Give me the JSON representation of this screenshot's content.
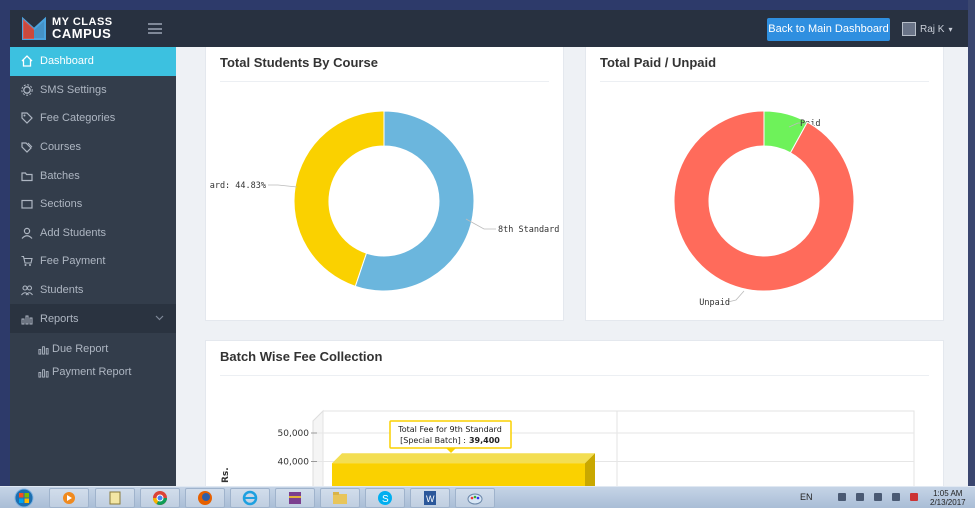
{
  "brand": {
    "line1": "MY CLASS",
    "line2": "CAMPUS"
  },
  "navbar": {
    "back_label": "Back to Main Dashboard",
    "user_name": "Raj K"
  },
  "sidebar": {
    "items": [
      {
        "label": "Dashboard",
        "icon": "home-icon"
      },
      {
        "label": "SMS Settings",
        "icon": "gear-icon"
      },
      {
        "label": "Fee Categories",
        "icon": "tag-icon"
      },
      {
        "label": "Courses",
        "icon": "tags-icon"
      },
      {
        "label": "Batches",
        "icon": "folder-icon"
      },
      {
        "label": "Sections",
        "icon": "rectangle-icon"
      },
      {
        "label": "Add Students",
        "icon": "user-icon"
      },
      {
        "label": "Fee Payment",
        "icon": "cart-icon"
      },
      {
        "label": "Students",
        "icon": "users-icon"
      },
      {
        "label": "Reports",
        "icon": "bar-chart-icon"
      }
    ],
    "sub_items": [
      {
        "label": "Due Report",
        "icon": "bar-chart-icon"
      },
      {
        "label": "Payment Report",
        "icon": "bar-chart-icon"
      }
    ]
  },
  "cards": {
    "students_by_course": {
      "title": "Total Students By Course"
    },
    "paid_unpaid": {
      "title": "Total Paid / Unpaid"
    },
    "batch_fee": {
      "title": "Batch Wise Fee Collection"
    }
  },
  "chart_data": [
    {
      "type": "pie",
      "donut": true,
      "title": "Total Students By Course",
      "slices": [
        {
          "label": "8th Standard",
          "value": 55.17,
          "color": "#6bb6dd"
        },
        {
          "label": "ard: 44.83%",
          "value": 44.83,
          "color": "#fad100"
        }
      ]
    },
    {
      "type": "pie",
      "donut": true,
      "title": "Total Paid / Unpaid",
      "slices": [
        {
          "label": "Paid",
          "value": 8,
          "color": "#6ef25a"
        },
        {
          "label": "Unpaid",
          "value": 92,
          "color": "#ff6b5b"
        }
      ]
    },
    {
      "type": "bar",
      "title": "Batch Wise Fee Collection",
      "ylabel": "Rs.",
      "ytick_labels": [
        "50,000",
        "40,000"
      ],
      "series": [
        {
          "values": [
            39400
          ],
          "color": "#fad100"
        }
      ],
      "tooltip": {
        "line1": "Total Fee for 9th Standard",
        "line2_prefix": "[Special Batch] :",
        "line2_value": "39,400"
      }
    }
  ],
  "taskbar": {
    "language": "EN",
    "time": "1:05 AM",
    "date": "2/13/2017"
  }
}
